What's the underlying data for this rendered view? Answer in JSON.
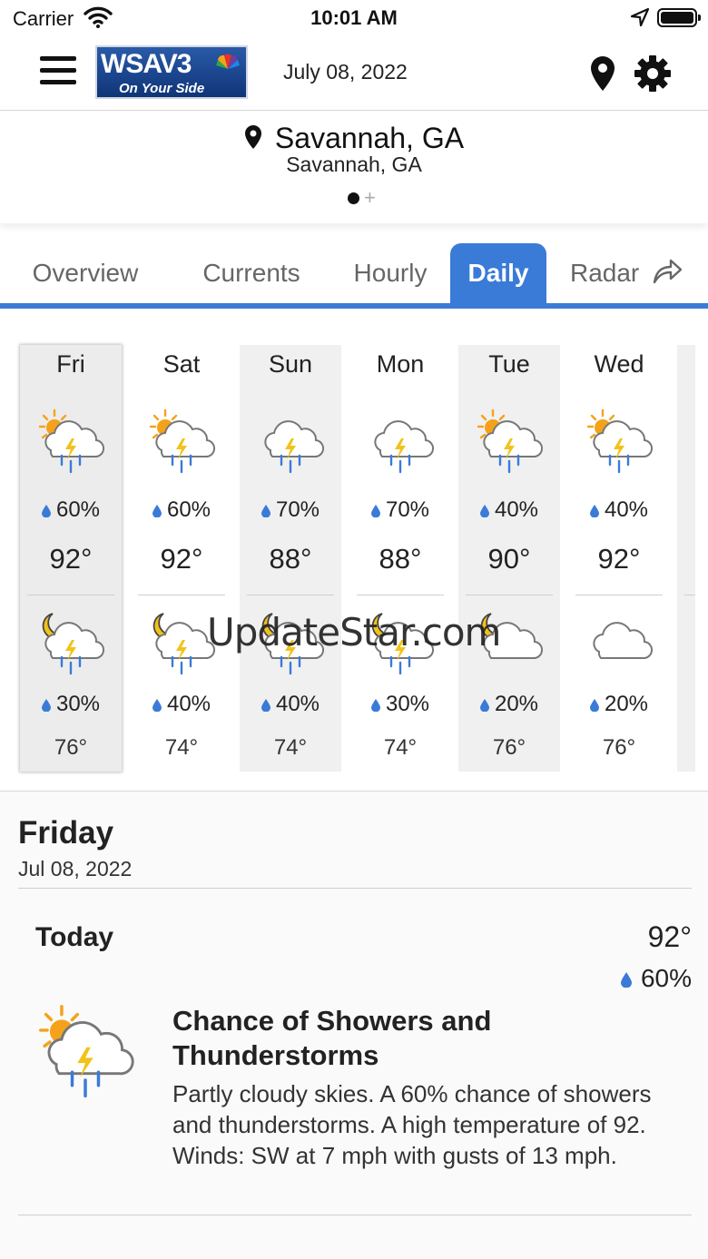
{
  "status_bar": {
    "carrier": "Carrier",
    "time": "10:01 AM",
    "icons": [
      "wifi-icon",
      "location-arrow-icon",
      "battery-icon"
    ]
  },
  "header": {
    "logo_text": "WSAV3",
    "logo_tagline": "On Your Side",
    "date": "July 08, 2022",
    "icons": [
      "menu-icon",
      "map-pin-icon",
      "gear-icon"
    ]
  },
  "location": {
    "title": "Savannah, GA",
    "subtitle": "Savannah, GA"
  },
  "tabs": [
    {
      "label": "Overview",
      "active": false
    },
    {
      "label": "Currents",
      "active": false
    },
    {
      "label": "Hourly",
      "active": false
    },
    {
      "label": "Daily",
      "active": true
    },
    {
      "label": "Radar",
      "active": false
    }
  ],
  "days": [
    {
      "name": "Fri",
      "day_icon": "partly-sunny-thunderstorm-icon",
      "day_pop": "60%",
      "high": "92°",
      "night_icon": "partly-cloudy-night-thunderstorm-icon",
      "night_pop": "30%",
      "low": "76°",
      "selected": true
    },
    {
      "name": "Sat",
      "day_icon": "partly-sunny-thunderstorm-icon",
      "day_pop": "60%",
      "high": "92°",
      "night_icon": "partly-cloudy-night-thunderstorm-icon",
      "night_pop": "40%",
      "low": "74°"
    },
    {
      "name": "Sun",
      "day_icon": "thunderstorm-icon",
      "day_pop": "70%",
      "high": "88°",
      "night_icon": "partly-cloudy-night-thunderstorm-icon",
      "night_pop": "40%",
      "low": "74°"
    },
    {
      "name": "Mon",
      "day_icon": "thunderstorm-icon",
      "day_pop": "70%",
      "high": "88°",
      "night_icon": "partly-cloudy-night-thunderstorm-icon",
      "night_pop": "30%",
      "low": "74°"
    },
    {
      "name": "Tue",
      "day_icon": "partly-sunny-thunderstorm-icon",
      "day_pop": "40%",
      "high": "90°",
      "night_icon": "partly-cloudy-night-icon",
      "night_pop": "20%",
      "low": "76°"
    },
    {
      "name": "Wed",
      "day_icon": "partly-sunny-thunderstorm-icon",
      "day_pop": "40%",
      "high": "92°",
      "night_icon": "cloudy-icon",
      "night_pop": "20%",
      "low": "76°"
    }
  ],
  "watermark": "UpdateStar.com",
  "detail": {
    "day_name": "Friday",
    "date": "Jul 08, 2022",
    "period": "Today",
    "high": "92°",
    "pop": "60%",
    "condition": "Chance of Showers and Thunderstorms",
    "description": "Partly cloudy skies.  A 60% chance of showers and thunderstorms.  A high temperature of 92.  Winds: SW at 7 mph with gusts of 13 mph."
  },
  "colors": {
    "accent": "#3a7bd8",
    "rain_drop": "#3a7bd8",
    "sun": "#f5a21b",
    "bolt": "#f2c21a"
  }
}
